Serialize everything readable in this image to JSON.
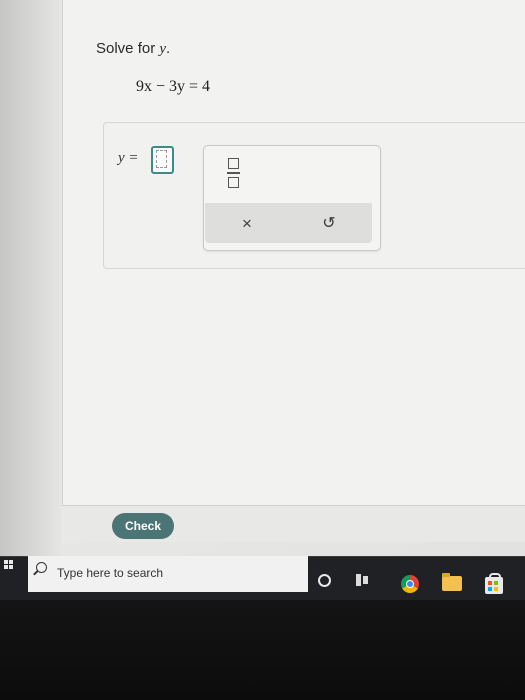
{
  "question": {
    "prompt_text": "Solve for ",
    "prompt_var": "y",
    "prompt_end": ".",
    "equation": "9x − 3y = 4"
  },
  "answer": {
    "label": "y =",
    "value": ""
  },
  "toolpad": {
    "fraction_icon": "fraction-icon",
    "clear_symbol": "×",
    "undo_symbol": "↺"
  },
  "footer": {
    "check_label": "Check"
  },
  "taskbar": {
    "search_placeholder": "Type here to search",
    "apps": [
      "cortana-icon",
      "task-view-icon",
      "chrome-icon",
      "file-explorer-icon",
      "store-icon"
    ]
  },
  "colors": {
    "check_button": "#4a7574",
    "answer_box_border": "#3d8a8a",
    "taskbar": "#1f2125"
  }
}
